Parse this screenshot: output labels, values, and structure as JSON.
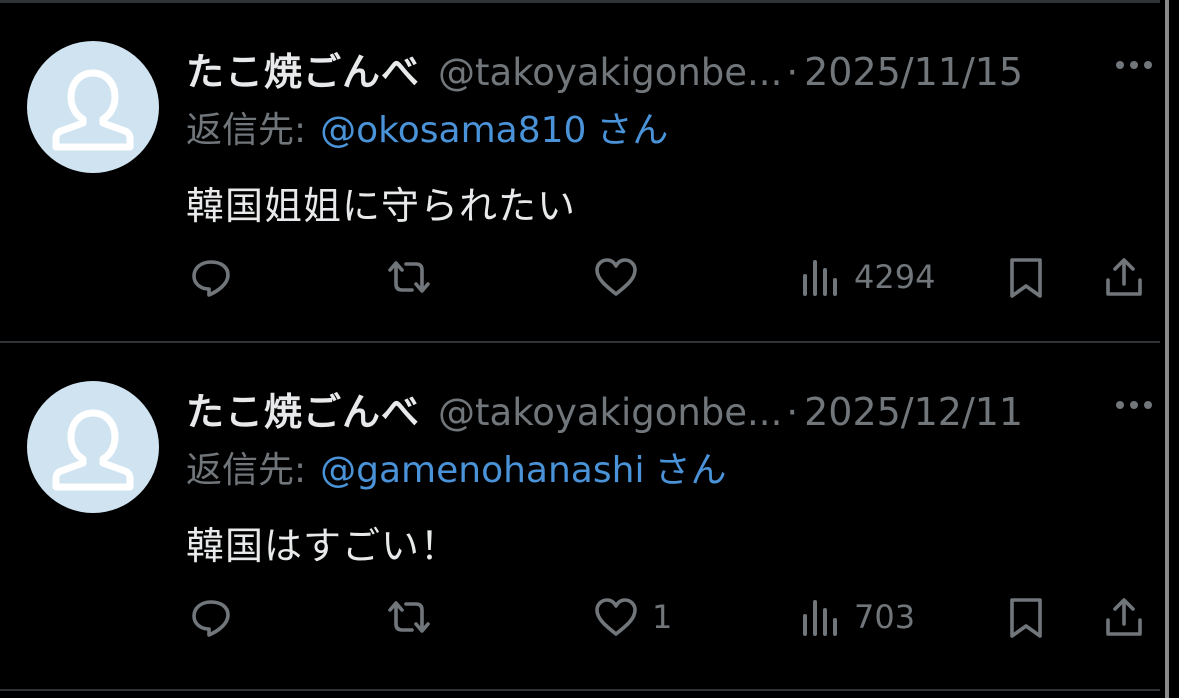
{
  "tweets": [
    {
      "display_name": "たこ焼ごんべ",
      "handle": "@takoyakigonbe...",
      "separator": "·",
      "date": "2025/11/15",
      "reply_prefix": "返信先:",
      "reply_handle": "@okosama810",
      "reply_suffix": "さん",
      "text": "韓国姐姐に守られたい",
      "like_count": "",
      "view_count": "4294"
    },
    {
      "display_name": "たこ焼ごんべ",
      "handle": "@takoyakigonbe...",
      "separator": "·",
      "date": "2025/12/11",
      "reply_prefix": "返信先:",
      "reply_handle": "@gamenohanashi",
      "reply_suffix": "さん",
      "text": "韓国はすごい！",
      "like_count": "1",
      "view_count": "703"
    }
  ],
  "icons": [
    "default-avatar-icon",
    "more-icon",
    "reply-icon",
    "retweet-icon",
    "like-icon",
    "views-icon",
    "bookmark-icon",
    "share-icon"
  ],
  "colors": {
    "background": "#000000",
    "primary_text": "#e7e9ea",
    "secondary_text": "#71767b",
    "link": "#4a93d8",
    "avatar_bg": "#cfe3f1"
  }
}
